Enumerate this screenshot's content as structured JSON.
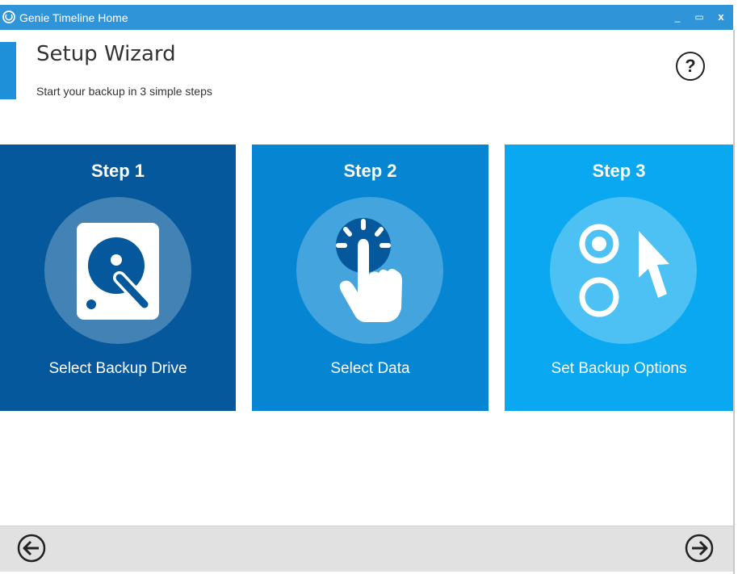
{
  "window": {
    "title": "Genie Timeline Home",
    "controls": {
      "minimize": "_",
      "maximize": "▭",
      "close": "x"
    }
  },
  "header": {
    "title": "Setup Wizard",
    "subtitle": "Start your backup in 3 simple steps",
    "help_label": "?"
  },
  "steps": [
    {
      "title": "Step 1",
      "label": "Select Backup Drive",
      "icon": "hard-drive-icon",
      "color": "#04589b"
    },
    {
      "title": "Step 2",
      "label": "Select Data",
      "icon": "tap-hand-icon",
      "color": "#0686d2"
    },
    {
      "title": "Step 3",
      "label": "Set Backup Options",
      "icon": "options-cursor-icon",
      "color": "#09a8f0"
    }
  ],
  "footer": {
    "back_icon": "arrow-left-icon",
    "next_icon": "arrow-right-icon"
  },
  "colors": {
    "titlebar": "#2f95d8",
    "footer": "#e1e1e1"
  }
}
